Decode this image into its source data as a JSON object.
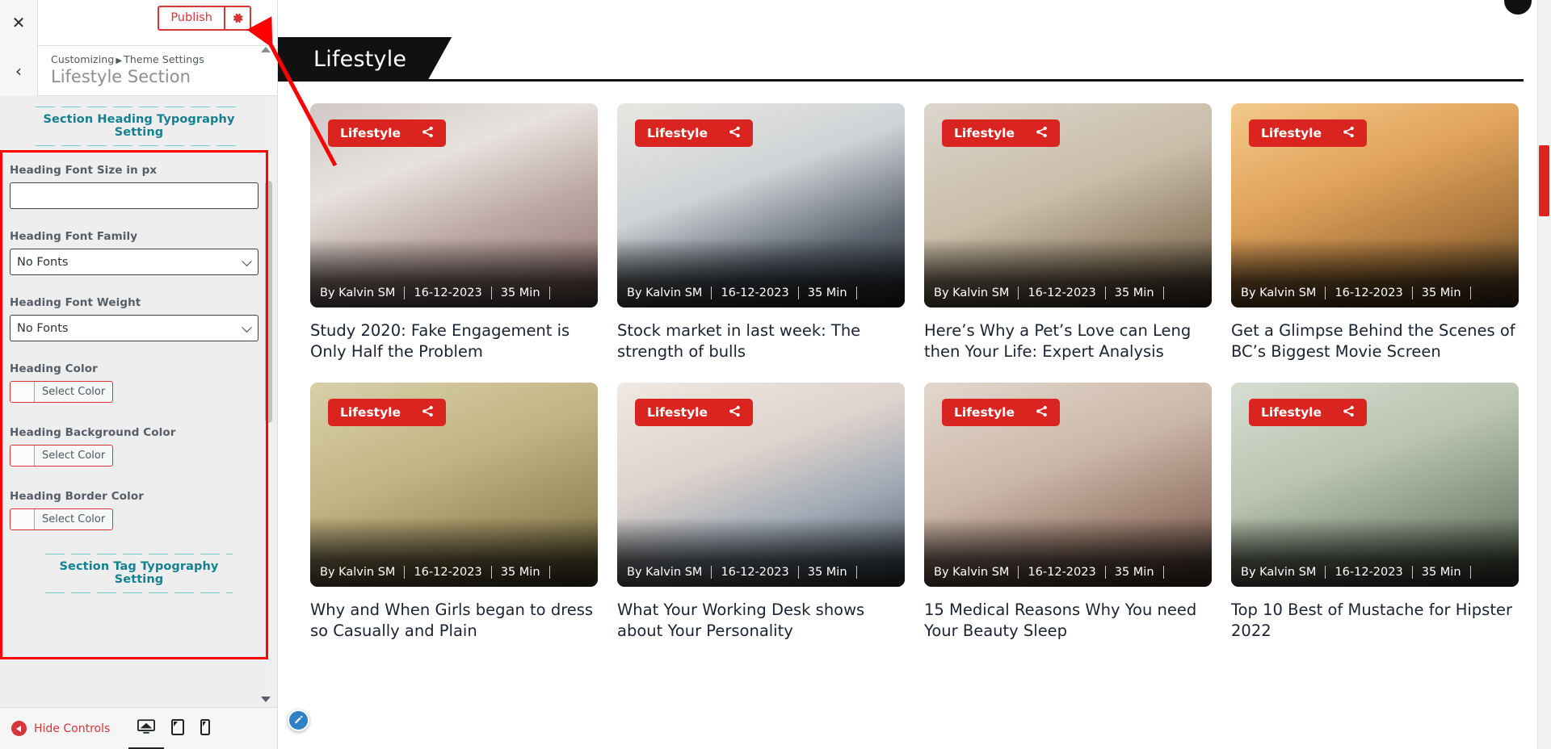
{
  "customizer": {
    "close_icon": "close-icon",
    "publish_label": "Publish",
    "gear_icon": "gear-icon",
    "back_icon": "chevron-left-icon",
    "breadcrumb_root": "Customizing",
    "breadcrumb_sep": "▶",
    "breadcrumb_parent": "Theme Settings",
    "section_title": "Lifestyle Section",
    "section_heading_typography": "Section Heading Typography Setting",
    "section_tag_typography": "Section Tag Typography Setting",
    "controls": [
      {
        "label": "Heading Font Size in px",
        "type": "text",
        "value": "",
        "placeholder": ""
      },
      {
        "label": "Heading Font Family",
        "type": "select",
        "value": "No Fonts"
      },
      {
        "label": "Heading Font Weight",
        "type": "select",
        "value": "No Fonts"
      },
      {
        "label": "Heading Color",
        "type": "color",
        "value": "Select Color"
      },
      {
        "label": "Heading Background Color",
        "type": "color",
        "value": "Select Color"
      },
      {
        "label": "Heading Border Color",
        "type": "color",
        "value": "Select Color"
      }
    ],
    "footer": {
      "hide_controls_label": "Hide Controls",
      "devices": [
        {
          "name": "desktop",
          "active": true
        },
        {
          "name": "tablet",
          "active": false
        },
        {
          "name": "mobile",
          "active": false
        }
      ]
    },
    "colors": {
      "accent_red": "#d63638",
      "teal": "#13818f",
      "annotation_red": "#ff0000"
    }
  },
  "preview": {
    "section_heading": "Lifestyle",
    "edit_pin_icon": "pencil-icon",
    "accent": "#d9241f",
    "cards": [
      {
        "tag": "Lifestyle",
        "share_icon": "share-icon",
        "author": "By Kalvin SM",
        "date": "16-12-2023",
        "read_time": "35 Min",
        "title": "Study 2020: Fake Engagement is Only Half the Problem",
        "img": "img-a"
      },
      {
        "tag": "Lifestyle",
        "share_icon": "share-icon",
        "author": "By Kalvin SM",
        "date": "16-12-2023",
        "read_time": "35 Min",
        "title": "Stock market in last week: The strength of bulls",
        "img": "img-b"
      },
      {
        "tag": "Lifestyle",
        "share_icon": "share-icon",
        "author": "By Kalvin SM",
        "date": "16-12-2023",
        "read_time": "35 Min",
        "title": "Here’s Why a Pet’s Love can Leng then Your Life: Expert Analysis",
        "img": "img-c"
      },
      {
        "tag": "Lifestyle",
        "share_icon": "share-icon",
        "author": "By Kalvin SM",
        "date": "16-12-2023",
        "read_time": "35 Min",
        "title": "Get a Glimpse Behind the Scenes of BC’s Biggest Movie Screen",
        "img": "img-d"
      },
      {
        "tag": "Lifestyle",
        "share_icon": "share-icon",
        "author": "By Kalvin SM",
        "date": "16-12-2023",
        "read_time": "35 Min",
        "title": "Why and When Girls began to dress so Casually and Plain",
        "img": "img-e"
      },
      {
        "tag": "Lifestyle",
        "share_icon": "share-icon",
        "author": "By Kalvin SM",
        "date": "16-12-2023",
        "read_time": "35 Min",
        "title": "What Your Working Desk shows about Your Personality",
        "img": "img-f"
      },
      {
        "tag": "Lifestyle",
        "share_icon": "share-icon",
        "author": "By Kalvin SM",
        "date": "16-12-2023",
        "read_time": "35 Min",
        "title": "15 Medical Reasons Why You need Your Beauty Sleep",
        "img": "img-g"
      },
      {
        "tag": "Lifestyle",
        "share_icon": "share-icon",
        "author": "By Kalvin SM",
        "date": "16-12-2023",
        "read_time": "35 Min",
        "title": "Top 10 Best of Mustache for Hipster 2022",
        "img": "img-h"
      }
    ]
  }
}
